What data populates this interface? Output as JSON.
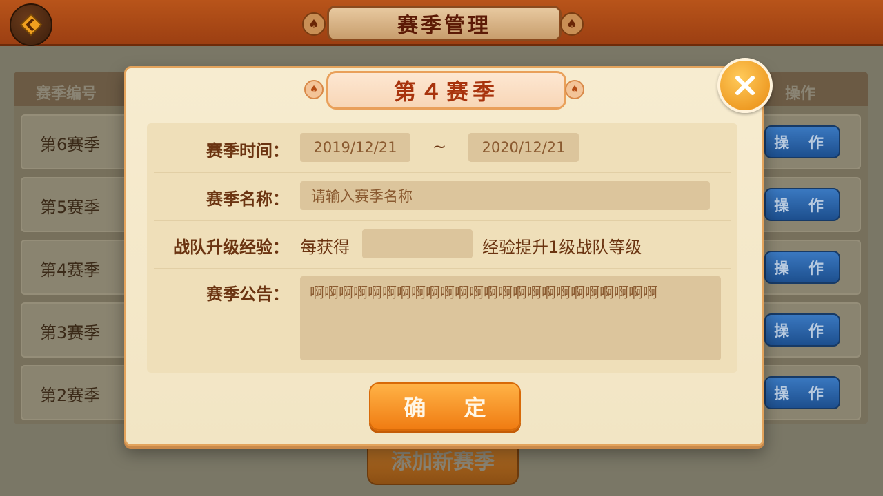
{
  "header": {
    "title": "赛季管理"
  },
  "table": {
    "columns": [
      "赛季编号",
      "操作"
    ],
    "rows": [
      {
        "season": "第6赛季",
        "action": "操 作"
      },
      {
        "season": "第5赛季",
        "action": "操 作"
      },
      {
        "season": "第4赛季",
        "action": "操 作"
      },
      {
        "season": "第3赛季",
        "action": "操 作"
      },
      {
        "season": "第2赛季",
        "action": "操 作"
      }
    ]
  },
  "add_button": "添加新赛季",
  "modal": {
    "title": "第４赛季",
    "season_time_label": "赛季时间：",
    "start_date": "2019/12/21",
    "range_separator": "~",
    "end_date": "2020/12/21",
    "name_label": "赛季名称：",
    "name_placeholder": "请输入赛季名称",
    "exp_label": "战队升级经验：",
    "exp_prefix": "每获得",
    "exp_value": "",
    "exp_suffix": "经验提升1级战队等级",
    "notice_label": "赛季公告：",
    "notice_value": "啊啊啊啊啊啊啊啊啊啊啊啊啊啊啊啊啊啊啊啊啊啊啊啊",
    "confirm_label": "确 定"
  },
  "colors": {
    "accent_orange": "#f07c12",
    "title_red": "#a8330d",
    "op_button_blue": "#1d4f8e"
  },
  "icons": {
    "back": "back-diamond-icon",
    "close": "close-x-icon",
    "spade": "spade-icon"
  }
}
